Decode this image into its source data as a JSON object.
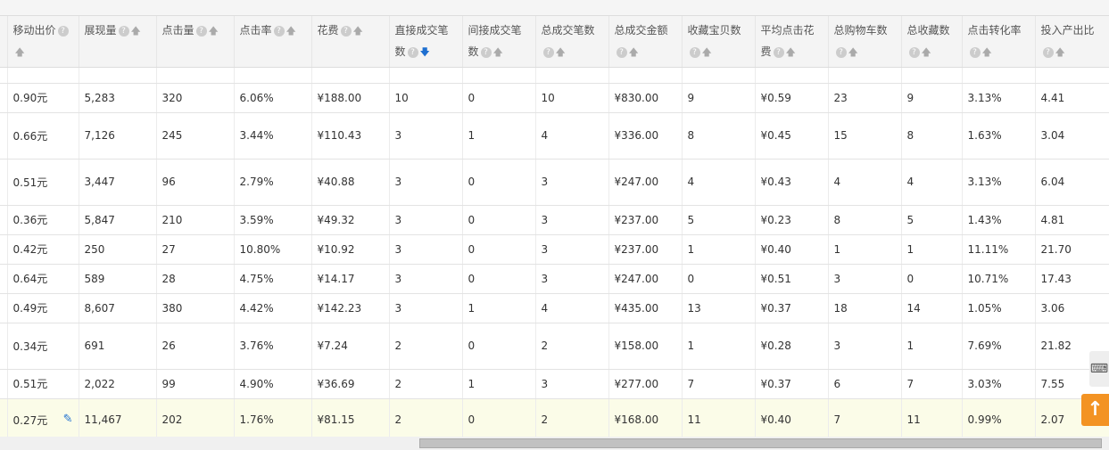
{
  "columns": [
    {
      "label": "",
      "help": false,
      "sort": ""
    },
    {
      "label": "移动出价",
      "help": true,
      "sort": "up"
    },
    {
      "label": "展现量",
      "help": true,
      "sort": "up"
    },
    {
      "label": "点击量",
      "help": true,
      "sort": "up"
    },
    {
      "label": "点击率",
      "help": true,
      "sort": "up"
    },
    {
      "label": "花费",
      "help": true,
      "sort": "up"
    },
    {
      "label": "直接成交笔数",
      "help": true,
      "sort": "down"
    },
    {
      "label": "间接成交笔数",
      "help": true,
      "sort": "up"
    },
    {
      "label": "总成交笔数",
      "help": true,
      "sort": "up"
    },
    {
      "label": "总成交金额",
      "help": true,
      "sort": "up"
    },
    {
      "label": "收藏宝贝数",
      "help": true,
      "sort": "up"
    },
    {
      "label": "平均点击花费",
      "help": true,
      "sort": "up"
    },
    {
      "label": "总购物车数",
      "help": true,
      "sort": "up"
    },
    {
      "label": "总收藏数",
      "help": true,
      "sort": "up"
    },
    {
      "label": "点击转化率",
      "help": true,
      "sort": "up"
    },
    {
      "label": "投入产出比",
      "help": true,
      "sort": "up"
    }
  ],
  "rows": [
    [
      "",
      "0.90元",
      "5,283",
      "320",
      "6.06%",
      "¥188.00",
      "10",
      "0",
      "10",
      "¥830.00",
      "9",
      "¥0.59",
      "23",
      "9",
      "3.13%",
      "4.41"
    ],
    [
      "",
      "0.66元",
      "7,126",
      "245",
      "3.44%",
      "¥110.43",
      "3",
      "1",
      "4",
      "¥336.00",
      "8",
      "¥0.45",
      "15",
      "8",
      "1.63%",
      "3.04"
    ],
    [
      "",
      "0.51元",
      "3,447",
      "96",
      "2.79%",
      "¥40.88",
      "3",
      "0",
      "3",
      "¥247.00",
      "4",
      "¥0.43",
      "4",
      "4",
      "3.13%",
      "6.04"
    ],
    [
      "",
      "0.36元",
      "5,847",
      "210",
      "3.59%",
      "¥49.32",
      "3",
      "0",
      "3",
      "¥237.00",
      "5",
      "¥0.23",
      "8",
      "5",
      "1.43%",
      "4.81"
    ],
    [
      "",
      "0.42元",
      "250",
      "27",
      "10.80%",
      "¥10.92",
      "3",
      "0",
      "3",
      "¥237.00",
      "1",
      "¥0.40",
      "1",
      "1",
      "11.11%",
      "21.70"
    ],
    [
      "",
      "0.64元",
      "589",
      "28",
      "4.75%",
      "¥14.17",
      "3",
      "0",
      "3",
      "¥247.00",
      "0",
      "¥0.51",
      "3",
      "0",
      "10.71%",
      "17.43"
    ],
    [
      "",
      "0.49元",
      "8,607",
      "380",
      "4.42%",
      "¥142.23",
      "3",
      "1",
      "4",
      "¥435.00",
      "13",
      "¥0.37",
      "18",
      "14",
      "1.05%",
      "3.06"
    ],
    [
      "",
      "0.34元",
      "691",
      "26",
      "3.76%",
      "¥7.24",
      "2",
      "0",
      "2",
      "¥158.00",
      "1",
      "¥0.28",
      "3",
      "1",
      "7.69%",
      "21.82"
    ],
    [
      "",
      "0.51元",
      "2,022",
      "99",
      "4.90%",
      "¥36.69",
      "2",
      "1",
      "3",
      "¥277.00",
      "7",
      "¥0.37",
      "6",
      "7",
      "3.03%",
      "7.55"
    ],
    [
      "",
      "0.27元",
      "11,467",
      "202",
      "1.76%",
      "¥81.15",
      "2",
      "0",
      "2",
      "¥168.00",
      "11",
      "¥0.40",
      "7",
      "11",
      "0.99%",
      "2.07"
    ]
  ],
  "highlight_row": 9,
  "help_glyph": "?",
  "sort_up_glyph": "🡅",
  "sort_down_glyph": "🡇",
  "edit_icon": "pencil-icon",
  "side_button_glyph": "⌨",
  "back_to_top_glyph": "↑"
}
